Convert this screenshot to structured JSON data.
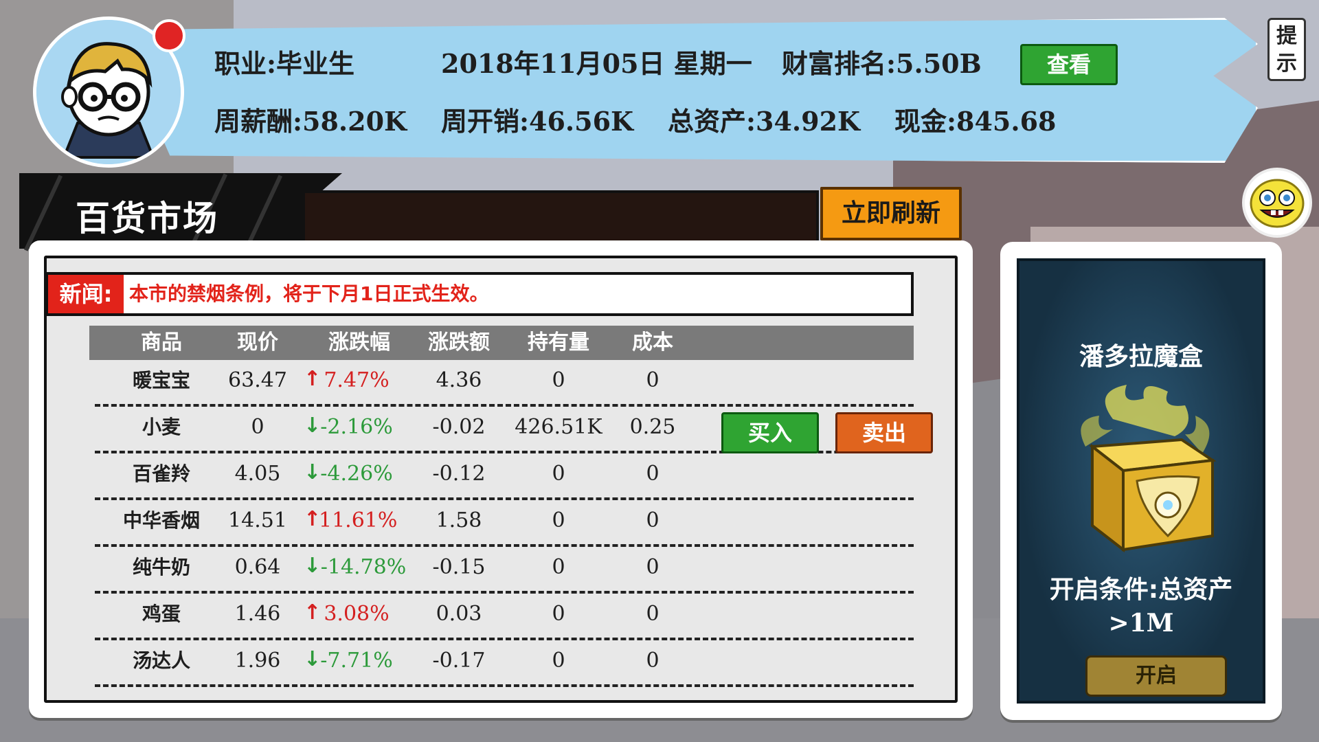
{
  "header": {
    "occupation": "职业:毕业生",
    "date": "2018年11月05日 星期一",
    "wealth_rank": "财富排名:5.50B",
    "view_label": "查看",
    "weekly_salary": "周薪酬:58.20K",
    "weekly_expense": "周开销:46.56K",
    "total_assets": "总资产:34.92K",
    "cash": "现金:845.68",
    "hint_label": "提示"
  },
  "market": {
    "title": "百货市场",
    "refresh_label": "立即刷新",
    "news_label": "新闻:",
    "news_text": "本市的禁烟条例，将于下月1日正式生效。",
    "columns": [
      "商品",
      "现价",
      "涨跌幅",
      "涨跌额",
      "持有量",
      "成本"
    ],
    "rows": [
      {
        "name": "暖宝宝",
        "price": "63.47",
        "trend": "up",
        "change_pct": "7.47%",
        "change_amt": "4.36",
        "holding": "0",
        "cost": "0"
      },
      {
        "name": "小麦",
        "price": "0",
        "trend": "down",
        "change_pct": "-2.16%",
        "change_amt": "-0.02",
        "holding": "426.51K",
        "cost": "0.25"
      },
      {
        "name": "百雀羚",
        "price": "4.05",
        "trend": "down",
        "change_pct": "-4.26%",
        "change_amt": "-0.12",
        "holding": "0",
        "cost": "0"
      },
      {
        "name": "中华香烟",
        "price": "14.51",
        "trend": "up",
        "change_pct": "11.61%",
        "change_amt": "1.58",
        "holding": "0",
        "cost": "0"
      },
      {
        "name": "纯牛奶",
        "price": "0.64",
        "trend": "down",
        "change_pct": "-14.78%",
        "change_amt": "-0.15",
        "holding": "0",
        "cost": "0"
      },
      {
        "name": "鸡蛋",
        "price": "1.46",
        "trend": "up",
        "change_pct": "3.08%",
        "change_amt": "0.03",
        "holding": "0",
        "cost": "0"
      },
      {
        "name": "汤达人",
        "price": "1.96",
        "trend": "down",
        "change_pct": "-7.71%",
        "change_amt": "-0.17",
        "holding": "0",
        "cost": "0"
      }
    ],
    "buy_label": "买入",
    "sell_label": "卖出"
  },
  "magic_box": {
    "title": "潘多拉魔盒",
    "condition_line1": "开启条件:总资产",
    "condition_line2": ">1M",
    "open_label": "开启"
  },
  "colors": {
    "banner": "#9fd4f0",
    "up": "#d42020",
    "down": "#2c9a3a",
    "buy": "#2fa432",
    "sell": "#e0641e",
    "refresh": "#f59a12"
  }
}
